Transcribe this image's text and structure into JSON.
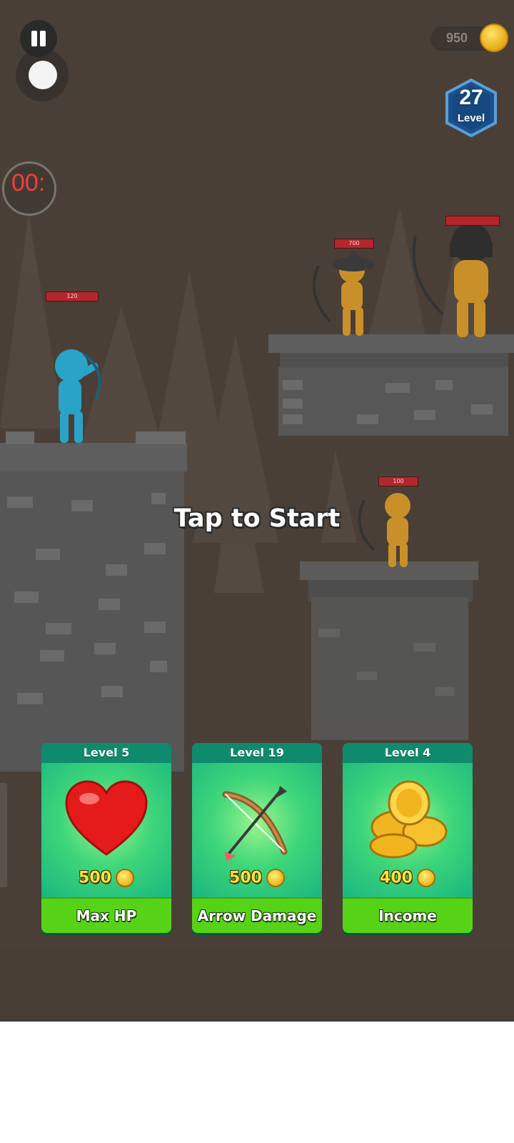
{
  "hud": {
    "timer_text": "00:",
    "coins": "950",
    "level_number": "27",
    "level_label": "Level"
  },
  "enemies_hp": [
    "700",
    "100"
  ],
  "player_hp": "120",
  "prompt": "Tap to Start",
  "upgrades": [
    {
      "level": "Level 5",
      "price": "500",
      "name": "Max HP",
      "icon": "heart-icon"
    },
    {
      "level": "Level 19",
      "price": "500",
      "name": "Arrow Damage",
      "icon": "bow-arrow-icon"
    },
    {
      "level": "Level 4",
      "price": "400",
      "name": "Income",
      "icon": "gold-coins-icon"
    }
  ],
  "colors": {
    "background": "#4a3f36",
    "card_green": "#16b47f",
    "button_green": "#56d317",
    "price_yellow": "#ffe33a",
    "player_blue": "#2aa3c9",
    "enemy_orange": "#c9902a"
  }
}
